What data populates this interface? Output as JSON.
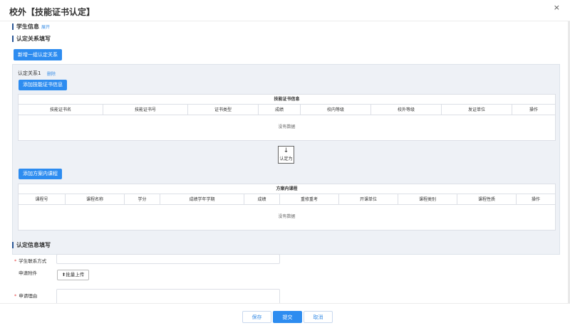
{
  "modal": {
    "title": "校外【技能证书认定】",
    "close_label": "×"
  },
  "student_section": {
    "title": "学生信息",
    "toggle": "展开"
  },
  "relation_section": {
    "title": "认定关系填写",
    "add_button": "新增一组认定关系"
  },
  "group": {
    "label": "认定关系1",
    "delete": "删除",
    "add_cert_button": "添加技能证书信息",
    "cert_table": {
      "caption": "技能证书信息",
      "columns": [
        "技能证书名",
        "技能证书号",
        "证书类型",
        "成绩",
        "校内等级",
        "校外等级",
        "发证单位",
        "操作"
      ],
      "empty": "没有数据"
    },
    "convert_label": "认定为",
    "convert_icon": "arrow-down-icon",
    "add_course_button": "添加方案内课程",
    "course_table": {
      "caption": "方案内课程",
      "columns": [
        "课程号",
        "课程名称",
        "学分",
        "成绩学年学期",
        "成绩",
        "重修重考",
        "开课单位",
        "课程类别",
        "课程性质",
        "操作"
      ],
      "empty": "没有数据"
    }
  },
  "info_section": {
    "title": "认定信息填写",
    "contact_label": "学生联系方式",
    "contact_value": "",
    "attachment_label": "申请附件",
    "upload_button": "批量上传",
    "reason_label": "申请理由",
    "reason_value": ""
  },
  "footer": {
    "save": "保存",
    "submit": "提交",
    "cancel": "取消"
  }
}
